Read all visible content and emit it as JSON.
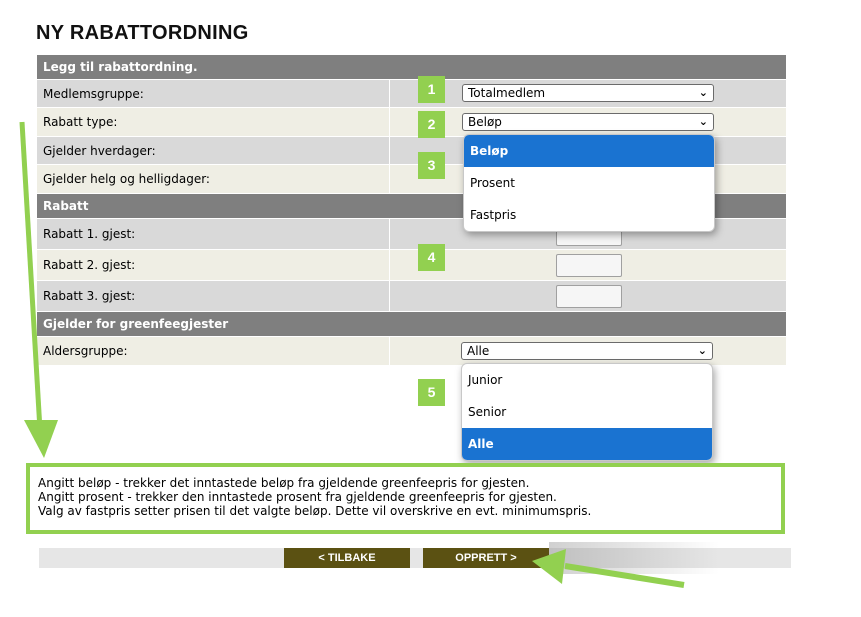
{
  "page_title": "NY RABATTORDNING",
  "sections": {
    "add": "Legg til rabattordning.",
    "discount": "Rabatt",
    "greenfee": "Gjelder for greenfeegjester"
  },
  "fields": {
    "member_group": {
      "label": "Medlemsgruppe:",
      "value": "Totalmedlem"
    },
    "discount_type": {
      "label": "Rabatt type:",
      "value": "Beløp"
    },
    "weekdays": {
      "label": "Gjelder hverdager:"
    },
    "weekends": {
      "label": "Gjelder helg og helligdager:"
    },
    "guest1": {
      "label": "Rabatt 1. gjest:"
    },
    "guest2": {
      "label": "Rabatt 2. gjest:"
    },
    "guest3": {
      "label": "Rabatt 3. gjest:"
    },
    "age_group": {
      "label": "Aldersgruppe:",
      "value": "Alle"
    }
  },
  "discount_type_options": [
    "Beløp",
    "Prosent",
    "Fastpris"
  ],
  "age_group_options": [
    "Junior",
    "Senior",
    "Alle"
  ],
  "badges": [
    "1",
    "2",
    "3",
    "4",
    "5"
  ],
  "info_lines": [
    "Angitt beløp - trekker det inntastede beløp fra gjeldende greenfeepris for gjesten.",
    "Angitt prosent - trekker den inntastede prosent fra gjeldende greenfeepris for gjesten.",
    "Valg av fastpris setter prisen til det valgte beløp. Dette vil overskrive en evt. minimumspris."
  ],
  "buttons": {
    "back": "< TILBAKE",
    "create": "OPPRETT >"
  },
  "colors": {
    "accent_green": "#92d050",
    "header_gray": "#7f7f7f",
    "button_olive": "#5b5112",
    "selected_blue": "#1a73d1"
  },
  "icons": {
    "select_chevron": "chevron-down-icon",
    "arrows": "arrow-icon"
  }
}
